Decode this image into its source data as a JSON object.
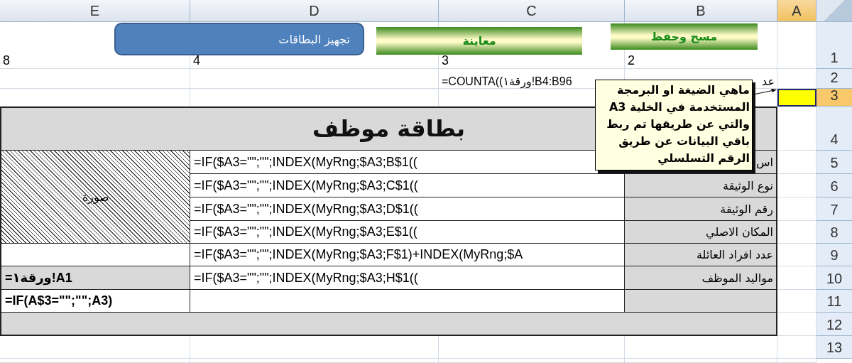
{
  "column_headers": [
    {
      "label": "A",
      "selected": true
    },
    {
      "label": "B",
      "selected": false
    },
    {
      "label": "C",
      "selected": false
    },
    {
      "label": "D",
      "selected": false
    },
    {
      "label": "E",
      "selected": false
    }
  ],
  "row_headers": [
    {
      "label": "1",
      "selected": false
    },
    {
      "label": "2",
      "selected": false
    },
    {
      "label": "3",
      "selected": true
    },
    {
      "label": "4",
      "selected": false
    },
    {
      "label": "5",
      "selected": false
    },
    {
      "label": "6",
      "selected": false
    },
    {
      "label": "7",
      "selected": false
    },
    {
      "label": "8",
      "selected": false
    },
    {
      "label": "9",
      "selected": false
    },
    {
      "label": "10",
      "selected": false
    },
    {
      "label": "11",
      "selected": false
    },
    {
      "label": "12",
      "selected": false
    },
    {
      "label": "13",
      "selected": false
    }
  ],
  "buttons": [
    {
      "label": "مسح وحفظ",
      "kind": "gradient"
    },
    {
      "label": "معاينة",
      "kind": "gradient"
    },
    {
      "label": "تجهيز البطاقات",
      "kind": "rounded"
    }
  ],
  "top_rows": [
    {
      "E": "8",
      "D": "4",
      "C": "3",
      "B": "2"
    },
    {
      "C": "=COUNTA((ورقة١!B4:B96",
      "B": "عد"
    }
  ],
  "card": {
    "title": "بطاقة موظف",
    "photo_label": "صورة",
    "fields": [
      {
        "label": "اس",
        "formula": "=IF($A3=\"\";\"\";INDEX(MyRng;$A3;B$1(("
      },
      {
        "label": "نوع الوثيقة",
        "formula": "=IF($A3=\"\";\"\";INDEX(MyRng;$A3;C$1(("
      },
      {
        "label": "رقم الوثيقة",
        "formula": "=IF($A3=\"\";\"\";INDEX(MyRng;$A3;D$1(("
      },
      {
        "label": "المكان الاصلي",
        "formula": "=IF($A3=\"\";\"\";INDEX(MyRng;$A3;E$1(("
      },
      {
        "label": "عدد افراد العائلة",
        "formula": "=IF($A3=\"\";\"\";INDEX(MyRng;$A3;F$1)+INDEX(MyRng;$A"
      },
      {
        "label": "مواليد الموظف",
        "formula": "=IF($A3=\"\";\"\";INDEX(MyRng;$A3;H$1(("
      }
    ],
    "side_cells": [
      {
        "text": "=ورقة١!A1",
        "shaded": true
      },
      {
        "text": "=IF(A$3=\"\";\"\";A3)",
        "shaded": false
      }
    ]
  },
  "comment": {
    "text": "ماهي الضيغة او البرمجة المستخدمة في الخلية A3 والتي عن طريقها تم ربط باقي البيانات عن طريق الرقم التسلسلي"
  }
}
